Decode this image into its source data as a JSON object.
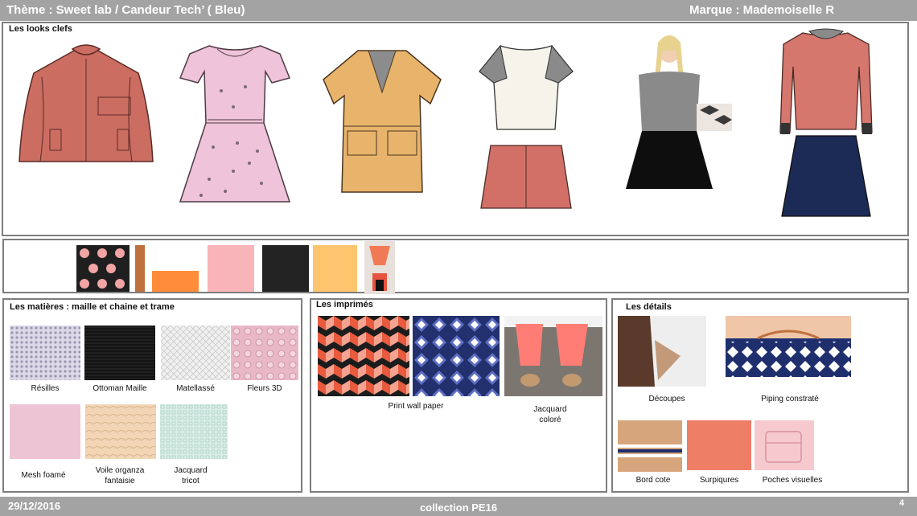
{
  "header": {
    "theme": "Thème : Sweet lab / Candeur Tech’ ( Bleu)",
    "brand": "Marque : Mademoiselle R"
  },
  "footer": {
    "date": "29/12/2016",
    "collection": "collection PE16",
    "page_number": "4"
  },
  "looks": {
    "title": "Les looks clefs"
  },
  "palette": {
    "colors": [
      "#1f1f1f",
      "#c0703d",
      "#ff8c3a",
      "#f8b4b8",
      "#232323",
      "#ffc56e",
      "#e8e0da"
    ]
  },
  "matieres": {
    "title": "Les matières : maille et chaine et trame",
    "items": [
      {
        "label": "Résilles"
      },
      {
        "label": "Ottoman Maille"
      },
      {
        "label": "Matellassé"
      },
      {
        "label": "Fleurs 3D"
      },
      {
        "label": "Mesh foamé"
      },
      {
        "label": "Voile organza fantaisie"
      },
      {
        "label": "Jacquard tricot"
      }
    ]
  },
  "imprimes": {
    "title": "Les imprimés",
    "items": [
      {
        "label": "Print wall paper"
      },
      {
        "label": "Jacquard coloré"
      }
    ]
  },
  "details": {
    "title": "Les détails",
    "items": [
      {
        "label": "Découpes"
      },
      {
        "label": "Piping constraté"
      },
      {
        "label": "Bord cote"
      },
      {
        "label": "Surpiqures"
      },
      {
        "label": "Poches visuelles"
      }
    ]
  }
}
